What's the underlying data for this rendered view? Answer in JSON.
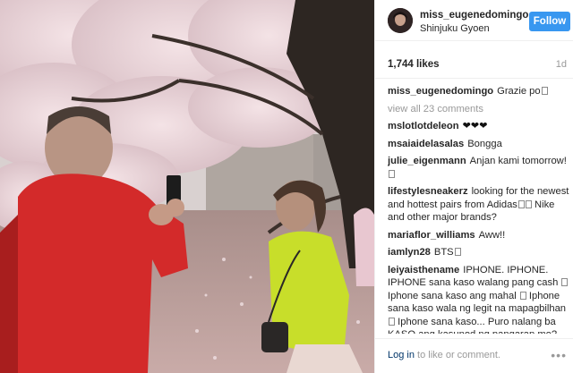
{
  "header": {
    "username": "miss_eugenedomingo",
    "location": "Shinjuku Gyoen",
    "follow_label": "Follow"
  },
  "stats": {
    "likes": "1,744 likes",
    "age": "1d"
  },
  "caption": {
    "username": "miss_eugenedomingo",
    "text": "Grazie po"
  },
  "view_all": "view all 23 comments",
  "comments": [
    {
      "user": "mslotlotdeleon",
      "text": "❤❤❤"
    },
    {
      "user": "msaiaidelasalas",
      "text": "Bongga"
    },
    {
      "user": "julie_eigenmann",
      "text": "Anjan kami tomorrow!"
    },
    {
      "user": "lifestylesneakerz",
      "text": "looking for the newest and hottest pairs from Adidas",
      "text2": "Nike and other major brands?"
    },
    {
      "user": "mariaflor_williams",
      "text": "Aww!!"
    },
    {
      "user": "iamlyn28",
      "text": "BTS"
    },
    {
      "user": "leiyaisthename",
      "text": "IPHONE. IPHONE. IPHONE sana kaso walang pang cash",
      "text2": "Iphone sana kaso ang mahal",
      "text3": "Iphone sana kaso wala ng legit na mapagbilhan",
      "text4": "Iphone sana kaso... Puro nalang ba KASO ang kasunod ng pangarap mo? Bakit hndi mo subukan ang @SELLPHONESPH para makulayan na"
    }
  ],
  "footer": {
    "login": "Log in",
    "rest": " to like or comment.",
    "more": "•••"
  },
  "colors": {
    "accent": "#3897f0",
    "link": "#003569",
    "muted": "#999999"
  },
  "icons": [
    "more-options-icon",
    "heart-emoji-icon"
  ]
}
